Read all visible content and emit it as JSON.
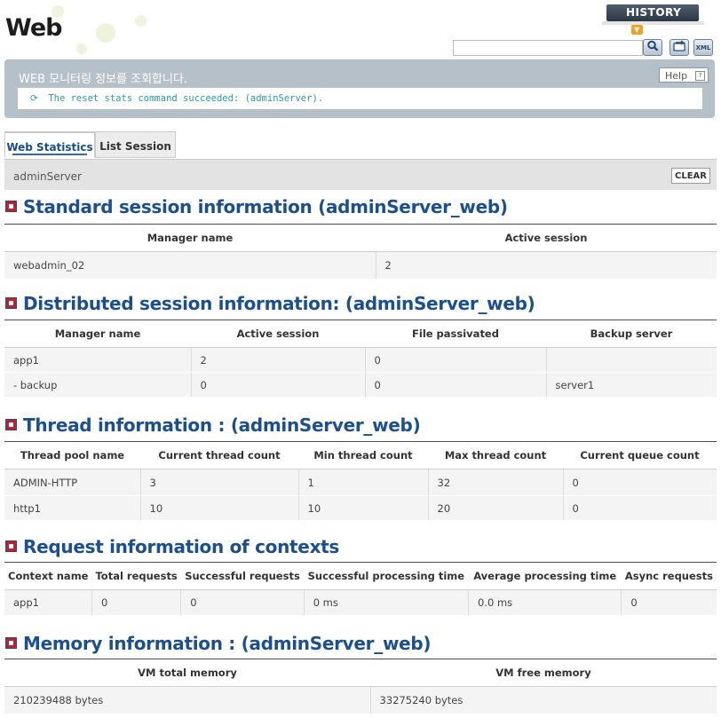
{
  "header": {
    "title": "Web",
    "history_label": "HISTORY",
    "search_placeholder": ""
  },
  "toolbar": {
    "icons": [
      "search-icon",
      "refresh-icon",
      "xml-export-icon"
    ],
    "xml_label": "XML"
  },
  "banner": {
    "title": "WEB 모니터링 정보를 조회합니다.",
    "help_label": "Help",
    "message": "The reset stats command succeeded: (adminServer)."
  },
  "tabs": [
    {
      "label": "Web Statistics",
      "active": true
    },
    {
      "label": "List Session",
      "active": false
    }
  ],
  "server_bar": {
    "server_name": "adminServer",
    "clear_label": "CLEAR"
  },
  "standard_session": {
    "title": "Standard session information (adminServer_web)",
    "headers": [
      "Manager name",
      "Active session"
    ],
    "rows": [
      [
        "webadmin_02",
        "2"
      ]
    ]
  },
  "distributed_session": {
    "title": "Distributed session information: (adminServer_web)",
    "headers": [
      "Manager name",
      "Active session",
      "File passivated",
      "Backup server"
    ],
    "rows": [
      [
        "app1",
        "2",
        "0",
        ""
      ],
      [
        "- backup",
        "0",
        "0",
        "server1"
      ]
    ]
  },
  "thread_info": {
    "title": "Thread information : (adminServer_web)",
    "headers": [
      "Thread pool name",
      "Current thread count",
      "Min thread count",
      "Max thread count",
      "Current queue count"
    ],
    "rows": [
      [
        "ADMIN-HTTP",
        "3",
        "1",
        "32",
        "0"
      ],
      [
        "http1",
        "10",
        "10",
        "20",
        "0"
      ]
    ]
  },
  "request_info": {
    "title": "Request information of contexts",
    "headers": [
      "Context name",
      "Total requests",
      "Successful requests",
      "Successful processing time",
      "Average processing time",
      "Async requests"
    ],
    "rows": [
      [
        "app1",
        "0",
        "0",
        "0 ms",
        "0.0 ms",
        "0"
      ]
    ]
  },
  "memory_info": {
    "title": "Memory information : (adminServer_web)",
    "headers": [
      "VM total memory",
      "VM free memory"
    ],
    "rows": [
      [
        "210239488 bytes",
        "33275240 bytes"
      ]
    ]
  },
  "colors": {
    "section_title": "#1b4f8f",
    "message_text": "#2c9aa8",
    "banner_bg": "#b6c0c9",
    "history_bg": "#2c3744"
  }
}
